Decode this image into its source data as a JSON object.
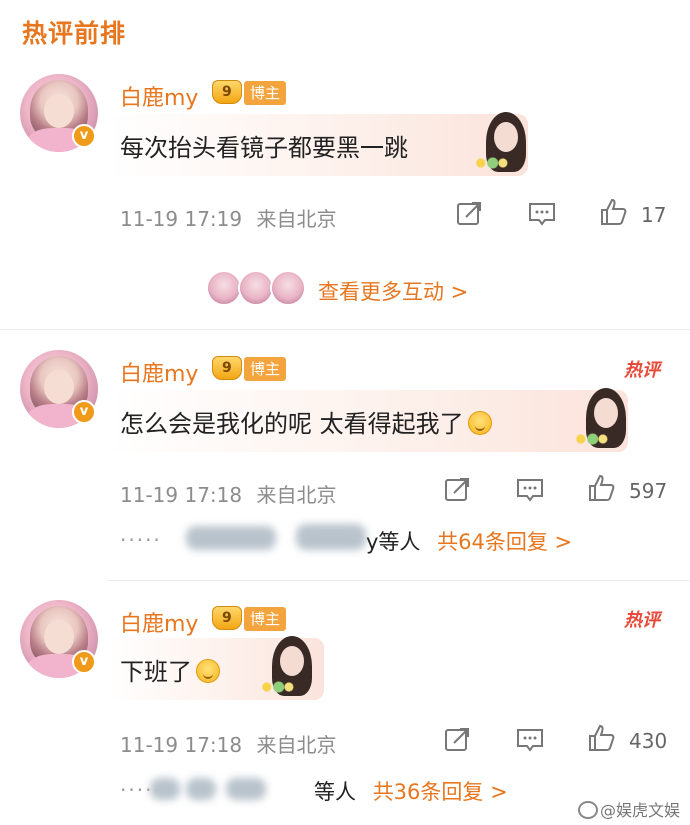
{
  "section_title": "热评前排",
  "comments": [
    {
      "username": "白鹿my",
      "level": "9",
      "author_tag": "博主",
      "verified": "v",
      "text": "每次抬头看镜子都要黑一跳",
      "time": "11-19 17:19",
      "location": "来自北京",
      "likes": "17",
      "hot_tag": ""
    },
    {
      "username": "白鹿my",
      "level": "9",
      "author_tag": "博主",
      "verified": "v",
      "text": "怎么会是我化的呢 太看得起我了",
      "time": "11-19 17:18",
      "location": "来自北京",
      "likes": "597",
      "hot_tag": "热评",
      "replies_visible": "y等人",
      "replies_count": "共64条回复 >"
    },
    {
      "username": "白鹿my",
      "level": "9",
      "author_tag": "博主",
      "verified": "v",
      "text": "下班了",
      "time": "11-19 17:18",
      "location": "来自北京",
      "likes": "430",
      "hot_tag": "热评",
      "replies_visible": "等人",
      "replies_count": "共36条回复 >"
    }
  ],
  "more_interactions": "查看更多互动 >",
  "ellipsis": "·····",
  "watermark": "@娱虎文娱",
  "colors": {
    "accent": "#e8761f",
    "hot": "#e84a3a",
    "badge": "#f3a43c",
    "meta": "#8c8c8c"
  },
  "icons": [
    "share-icon",
    "comment-icon",
    "like-icon",
    "verified-icon",
    "crown-icon",
    "smile-emoji-icon"
  ]
}
